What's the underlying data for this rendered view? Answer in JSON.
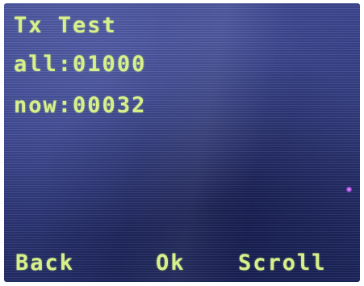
{
  "screen": {
    "title": "Tx Test",
    "lines": [
      {
        "label": "all",
        "value": "01000"
      },
      {
        "label": "now",
        "value": "00032"
      }
    ]
  },
  "softkeys": {
    "left": "Back",
    "center": "Ok",
    "right": "Scroll"
  },
  "colors": {
    "text": "#d8f08a",
    "background": "#3b4590"
  }
}
